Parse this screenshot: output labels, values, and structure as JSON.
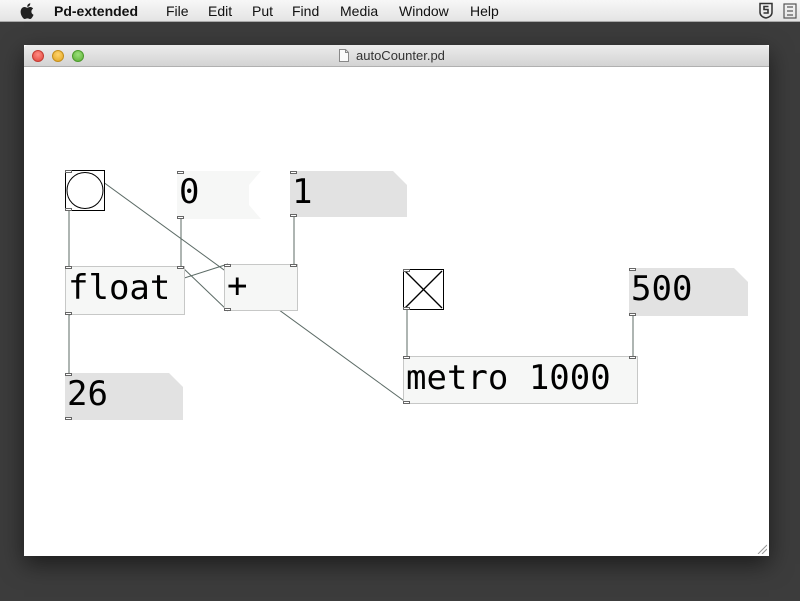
{
  "menubar": {
    "app_name": "Pd-extended",
    "items": [
      "File",
      "Edit",
      "Put",
      "Find",
      "Media",
      "Window",
      "Help"
    ]
  },
  "window": {
    "title": "autoCounter.pd"
  },
  "patch": {
    "message_zero": "0",
    "message_one": "1",
    "float_object": "float",
    "plus_object": "+",
    "counter_number": "26",
    "metro_object": "metro 1000",
    "interval_number": "500"
  },
  "icons": {
    "apple": "apple-icon",
    "status": "pd-status-icon",
    "document": "document-icon",
    "bang": "bang-circle-icon",
    "toggle": "toggle-x-icon"
  }
}
